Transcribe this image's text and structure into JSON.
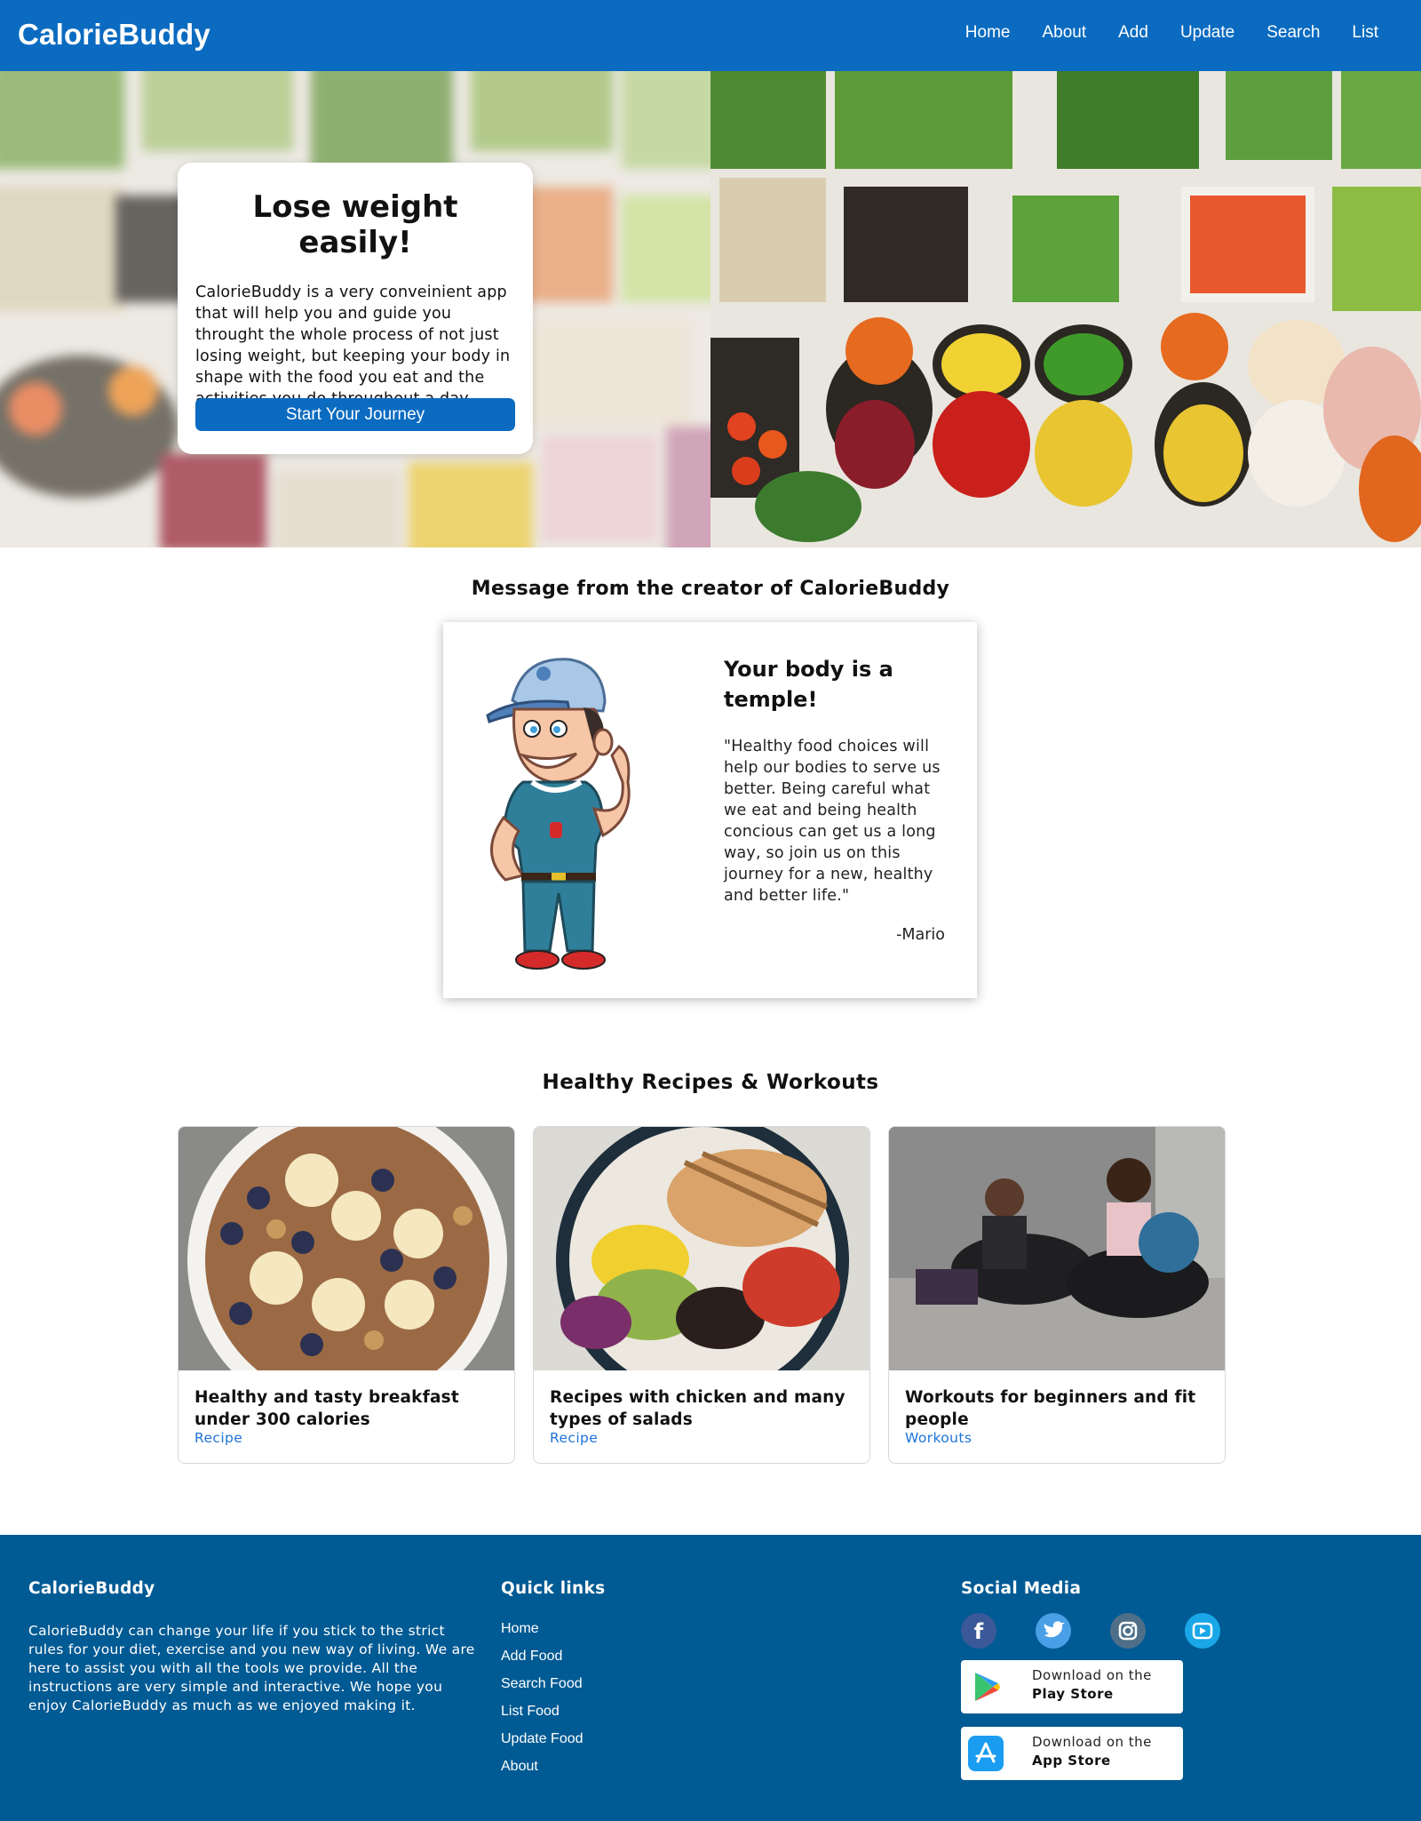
{
  "navbar": {
    "brand": "CalorieBuddy",
    "links": [
      "Home",
      "About",
      "Add",
      "Update",
      "Search",
      "List"
    ]
  },
  "hero": {
    "title": "Lose weight easily!",
    "text": "CalorieBuddy is a very conveinient app that will help you and guide you throught the whole process of not just losing weight, but keeping your body in shape with the food you eat and the activities you do throughout a day.",
    "button": "Start Your Journey"
  },
  "creator": {
    "heading": "Message from the creator of CalorieBuddy",
    "title": "Your body is a temple!",
    "quote": "\"Healthy food choices will help our bodies to serve us better. Being careful what we eat and being health concious can get us a long way, so join us on this journey for a new, healthy and better life.\"",
    "author": "-Mario"
  },
  "recipes": {
    "heading": "Healthy Recipes & Workouts",
    "cards": [
      {
        "title": "Healthy and tasty breakfast under 300 calories",
        "tag": "Recipe"
      },
      {
        "title": "Recipes with chicken and many types of salads",
        "tag": "Recipe"
      },
      {
        "title": "Workouts for beginners and fit people",
        "tag": "Workouts"
      }
    ]
  },
  "footer": {
    "about_title": "CalorieBuddy",
    "about_text": "CalorieBuddy can change your life if you stick to the strict rules for your diet, exercise and you new way of living. We are here to assist you with all the tools we provide. All the instructions are very simple and interactive. We hope you enjoy CalorieBuddy as much as we enjoyed making it.",
    "links_title": "Quick links",
    "links": [
      "Home",
      "Add Food",
      "Search Food",
      "List Food",
      "Update Food",
      "About"
    ],
    "social_title": "Social Media",
    "socials": [
      "facebook-icon",
      "twitter-icon",
      "instagram-icon",
      "youtube-icon"
    ],
    "play_store": {
      "small": "Download on the",
      "big": "Play Store"
    },
    "app_store": {
      "small": "Download on the",
      "big": "App Store"
    }
  },
  "colors": {
    "nav": "#0b6bc0",
    "footer": "#005a93",
    "accent_link": "#1e73d8"
  }
}
